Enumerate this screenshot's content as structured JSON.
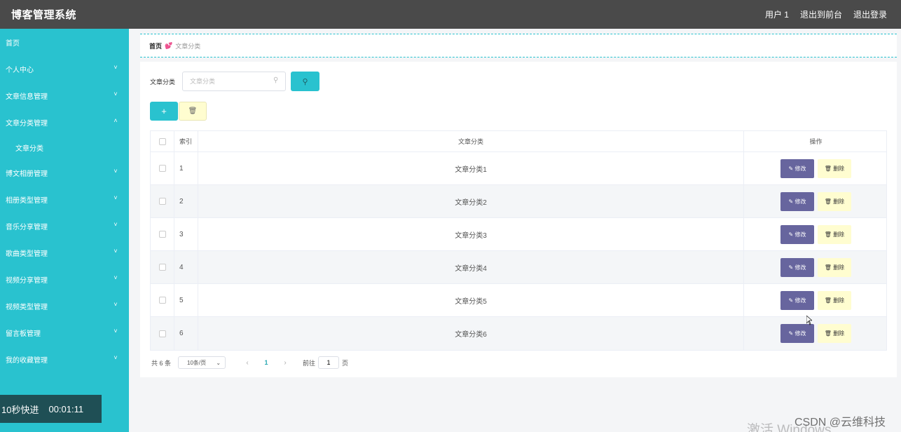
{
  "header": {
    "title": "博客管理系统",
    "user": "用户 1",
    "to_front": "退出到前台",
    "logout": "退出登录"
  },
  "sidebar": {
    "items": [
      {
        "label": "首页",
        "has_chevron": false
      },
      {
        "label": "个人中心",
        "has_chevron": true,
        "expanded": false
      },
      {
        "label": "文章信息管理",
        "has_chevron": true,
        "expanded": false
      },
      {
        "label": "文章分类管理",
        "has_chevron": true,
        "expanded": true
      },
      {
        "label": "文章分类",
        "sub": true
      },
      {
        "label": "博文相册管理",
        "has_chevron": true,
        "expanded": false
      },
      {
        "label": "相册类型管理",
        "has_chevron": true,
        "expanded": false
      },
      {
        "label": "音乐分享管理",
        "has_chevron": true,
        "expanded": false
      },
      {
        "label": "歌曲类型管理",
        "has_chevron": true,
        "expanded": false
      },
      {
        "label": "视频分享管理",
        "has_chevron": true,
        "expanded": false
      },
      {
        "label": "视频类型管理",
        "has_chevron": true,
        "expanded": false
      },
      {
        "label": "留言板管理",
        "has_chevron": true,
        "expanded": false
      },
      {
        "label": "我的收藏管理",
        "has_chevron": true,
        "expanded": false
      }
    ]
  },
  "timer": {
    "label": "10秒快进",
    "time": "00:01:11"
  },
  "breadcrumb": {
    "home": "首页",
    "separator": "💕",
    "current": "文章分类"
  },
  "search": {
    "label": "文章分类",
    "placeholder": "文章分类",
    "value": ""
  },
  "table": {
    "headers": {
      "index": "索引",
      "name": "文章分类",
      "ops": "操作"
    },
    "rows": [
      {
        "index": "1",
        "name": "文章分类1"
      },
      {
        "index": "2",
        "name": "文章分类2"
      },
      {
        "index": "3",
        "name": "文章分类3"
      },
      {
        "index": "4",
        "name": "文章分类4"
      },
      {
        "index": "5",
        "name": "文章分类5"
      },
      {
        "index": "6",
        "name": "文章分类6"
      }
    ],
    "edit_label": "✎ 修改",
    "delete_label": "🗑 删除"
  },
  "pagination": {
    "total": "共 6 条",
    "page_size": "10条/页",
    "current_page": "1",
    "goto_prefix": "前往",
    "goto_value": "1",
    "goto_suffix": "页"
  },
  "watermarks": {
    "csdn": "CSDN @云维科技",
    "windows": "激活 Windows"
  },
  "colors": {
    "accent": "#29c2cf",
    "header": "#4a4a4a",
    "edit": "#67659e",
    "delete": "#fffdd0"
  }
}
